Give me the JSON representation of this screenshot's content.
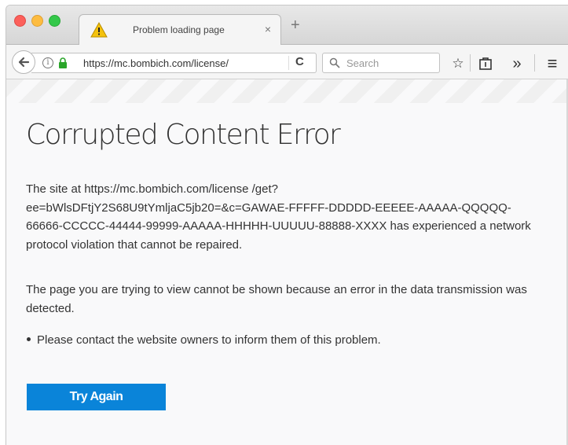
{
  "tab": {
    "title": "Problem loading page",
    "close_glyph": "×",
    "icon": "warning-icon"
  },
  "new_tab_glyph": "+",
  "navbar": {
    "url": "https://mc.bombich.com/license/",
    "search_placeholder": "Search",
    "reload_glyph": "C",
    "info_glyph": "i",
    "overflow_glyph": "»",
    "menu_glyph": "≡",
    "bookmark_glyph": "☆"
  },
  "error": {
    "title": "Corrupted Content Error",
    "paragraph1": "The site at https://mc.bombich.com/license /get?ee=bWlsDFtjY2S68U9tYmljaC5jb20=&c=GAWAE-FFFFF-DDDDD-EEEEE-AAAAA-QQQQQ-66666-CCCCC-44444-99999-AAAAA-HHHHH-UUUUU-88888-XXXX has experienced a network protocol violation that cannot be repaired.",
    "paragraph2": "The page you are trying to view cannot be shown because an error in the data transmission was detected.",
    "bullet": "Please contact the website owners to inform them of this problem.",
    "button_label": "Try Again"
  },
  "colors": {
    "accent": "#0a84d9",
    "close_dot": "#fc605b",
    "minimize_dot": "#fdbc40",
    "zoom_dot": "#34c84a",
    "warning": "#f4c20d"
  }
}
